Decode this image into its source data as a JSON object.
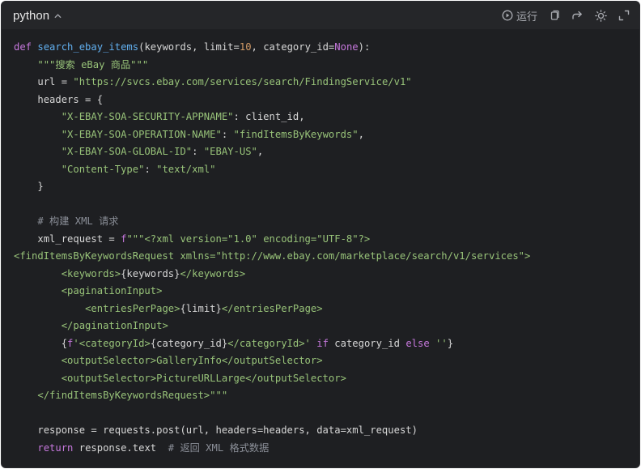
{
  "header": {
    "language": "python",
    "run_label": "运行",
    "icons": [
      "chevron-up-icon",
      "play-circle-icon",
      "copy-icon",
      "redo-icon",
      "sun-icon",
      "expand-icon"
    ]
  },
  "colors": {
    "background": "#1e1f22",
    "header": "#252629",
    "keyword": "#c678dd",
    "function": "#61afef",
    "string": "#98c379",
    "number": "#d19a66",
    "comment": "#8b8f98",
    "text": "#d7d7d7"
  },
  "code": {
    "l1": {
      "kw": "def",
      "sp": " ",
      "fn": "search_ebay_items",
      "a": "(keywords, limit=",
      "num": "10",
      "b": ", category_id=",
      "kw2": "None",
      "c": "):"
    },
    "l2": {
      "indent": "    ",
      "str": "\"\"\"搜索 eBay 商品\"\"\""
    },
    "l3": {
      "indent": "    ",
      "a": "url = ",
      "str": "\"https://svcs.ebay.com/services/search/FindingService/v1\""
    },
    "l4": {
      "indent": "    ",
      "a": "headers = {"
    },
    "l5": {
      "indent": "        ",
      "str": "\"X-EBAY-SOA-SECURITY-APPNAME\"",
      "a": ": client_id,"
    },
    "l6": {
      "indent": "        ",
      "str": "\"X-EBAY-SOA-OPERATION-NAME\"",
      "a": ": ",
      "str2": "\"findItemsByKeywords\"",
      "b": ","
    },
    "l7": {
      "indent": "        ",
      "str": "\"X-EBAY-SOA-GLOBAL-ID\"",
      "a": ": ",
      "str2": "\"EBAY-US\"",
      "b": ","
    },
    "l8": {
      "indent": "        ",
      "str": "\"Content-Type\"",
      "a": ": ",
      "str2": "\"text/xml\""
    },
    "l9": {
      "indent": "    ",
      "a": "}"
    },
    "l10": {
      "a": ""
    },
    "l11": {
      "indent": "    ",
      "cm": "# 构建 XML 请求"
    },
    "l12": {
      "indent": "    ",
      "a": "xml_request = ",
      "kw": "f",
      "str": "\"\"\"<?xml version=\"1.0\" encoding=\"UTF-8\"?>"
    },
    "l13": {
      "str": "<findItemsByKeywordsRequest xmlns=\"http://www.ebay.com/marketplace/search/v1/services\">"
    },
    "l14": {
      "indent": "        ",
      "s1": "<keywords>",
      "a": "{keywords}",
      "s2": "</keywords>"
    },
    "l15": {
      "indent": "        ",
      "s1": "<paginationInput>"
    },
    "l16": {
      "indent": "            ",
      "s1": "<entriesPerPage>",
      "a": "{limit}",
      "s2": "</entriesPerPage>"
    },
    "l17": {
      "indent": "        ",
      "s1": "</paginationInput>"
    },
    "l18": {
      "indent": "        ",
      "a": "{",
      "kw": "f",
      "s1": "'<categoryId>",
      "b": "{category_id}",
      "s2": "</categoryId>'",
      "sp1": " ",
      "kw2": "if",
      "c": " category_id ",
      "kw3": "else",
      "sp2": " ",
      "s3": "''",
      "d": "}"
    },
    "l19": {
      "indent": "        ",
      "s1": "<outputSelector>GalleryInfo</outputSelector>"
    },
    "l20": {
      "indent": "        ",
      "s1": "<outputSelector>PictureURLLarge</outputSelector>"
    },
    "l21": {
      "indent": "    ",
      "s1": "</findItemsByKeywordsRequest>\"\"\""
    },
    "l22": {
      "a": ""
    },
    "l23": {
      "indent": "    ",
      "a": "response = requests.post(url, headers=headers, data=xml_request)"
    },
    "l24": {
      "indent": "    ",
      "kw": "return",
      "a": " response.text  ",
      "cm": "# 返回 XML 格式数据"
    }
  }
}
